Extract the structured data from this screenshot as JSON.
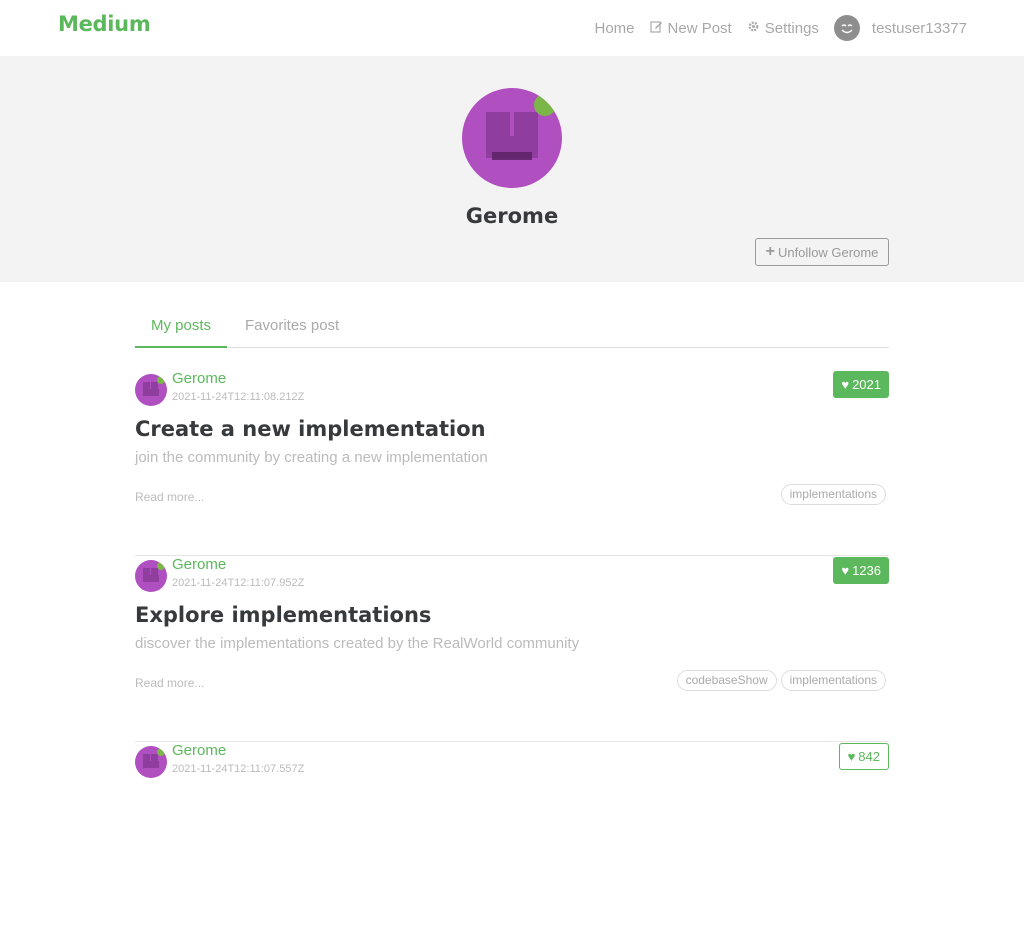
{
  "navbar": {
    "brand": "Medium",
    "home": "Home",
    "new_post": "New Post",
    "settings": "Settings",
    "username": "testuser13377"
  },
  "profile": {
    "name": "Gerome",
    "follow_button": "Unfollow Gerome"
  },
  "tabs": [
    {
      "label": "My posts",
      "active": true
    },
    {
      "label": "Favorites post",
      "active": false
    }
  ],
  "articles": [
    {
      "author": "Gerome",
      "date": "2021-11-24T12:11:08.212Z",
      "likes": "2021",
      "title": "Create a new implementation",
      "description": "join the community by creating a new implementation",
      "read_more": "Read more...",
      "tags": [
        "implementations"
      ]
    },
    {
      "author": "Gerome",
      "date": "2021-11-24T12:11:07.952Z",
      "likes": "1236",
      "title": "Explore implementations",
      "description": "discover the implementations created by the RealWorld community",
      "read_more": "Read more...",
      "tags": [
        "codebaseShow",
        "implementations"
      ]
    },
    {
      "author": "Gerome",
      "date": "2021-11-24T12:11:07.557Z",
      "likes": "842",
      "title": "",
      "description": "",
      "read_more": "",
      "tags": []
    }
  ],
  "colors": {
    "accent": "#5cb85c",
    "banner": "#f3f3f3",
    "avatar": "#b04fc0"
  }
}
